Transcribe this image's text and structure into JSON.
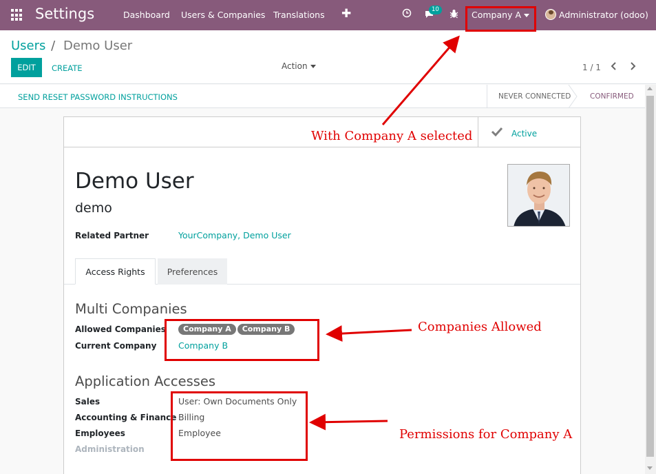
{
  "navbar": {
    "app_title": "Settings",
    "menu": [
      "Dashboard",
      "Users & Companies",
      "Translations"
    ],
    "plus_label": "✚",
    "messages_count": "10",
    "company": "Company A",
    "user": "Administrator (odoo)"
  },
  "breadcrumb": {
    "parent": "Users",
    "separator": "/",
    "current": "Demo User"
  },
  "toolbar": {
    "edit_label": "EDIT",
    "create_label": "CREATE",
    "action_label": "Action",
    "pager": "1 / 1"
  },
  "statusbar": {
    "reset_label": "SEND RESET PASSWORD INSTRUCTIONS",
    "stage_never": "NEVER CONNECTED",
    "stage_confirmed": "CONFIRMED"
  },
  "form": {
    "active_label": "Active",
    "name": "Demo User",
    "login": "demo",
    "related_partner_label": "Related Partner",
    "related_partner_value": "YourCompany, Demo User",
    "tabs": [
      "Access Rights",
      "Preferences"
    ],
    "multi_companies": {
      "title": "Multi Companies",
      "allowed_label": "Allowed Companies",
      "allowed": [
        "Company A",
        "Company B"
      ],
      "current_label": "Current Company",
      "current_value": "Company B"
    },
    "app_accesses": {
      "title": "Application Accesses",
      "rows": [
        {
          "label": "Sales",
          "value": "User: Own Documents Only"
        },
        {
          "label": "Accounting & Finance",
          "value": "Billing"
        },
        {
          "label": "Employees",
          "value": "Employee"
        },
        {
          "label": "Administration",
          "value": ""
        }
      ]
    }
  },
  "annotations": {
    "company_selected": "With Company A selected",
    "companies_allowed": "Companies Allowed",
    "permissions": "Permissions for Company A",
    "color": "#e00000"
  },
  "colors": {
    "navbar": "#875a7b",
    "accent": "#00a09d"
  }
}
